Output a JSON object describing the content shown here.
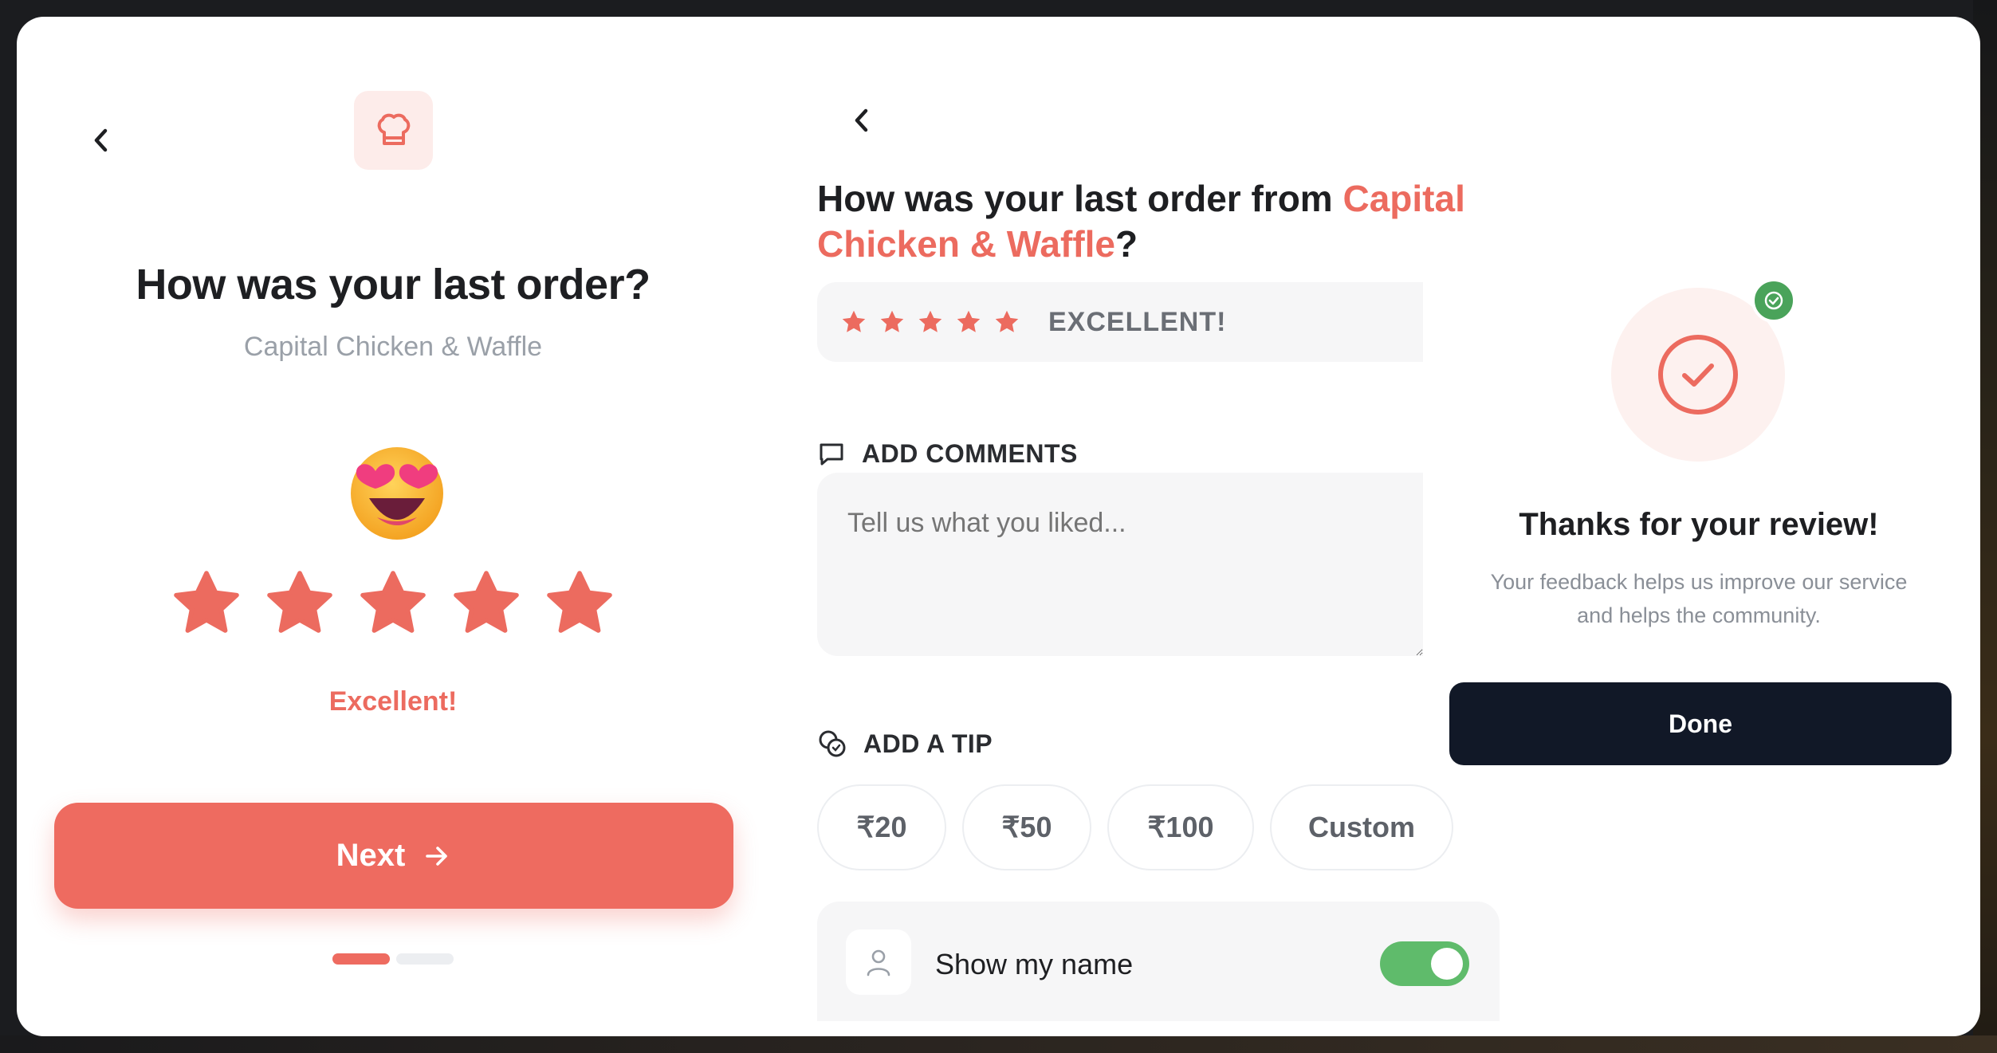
{
  "colors": {
    "accent": "#ec6b5f",
    "accent_bg": "#fdecea",
    "dark": "#111827",
    "success": "#4aa35a",
    "toggle_on": "#5fbb6b"
  },
  "left_panel": {
    "back_icon": "chevron-left-icon",
    "brand_icon": "chef-hat-icon",
    "title": "How was your last order?",
    "subtitle": "Capital Chicken & Waffle",
    "emoji_icon": "heart-eyes-emoji-icon",
    "rating": {
      "value": 5,
      "max": 5
    },
    "rating_text": "Excellent!",
    "next_label": "Next",
    "next_icon": "arrow-right-icon",
    "progress": {
      "current_step": 1,
      "total_steps": 2
    }
  },
  "middle_panel": {
    "back_icon": "chevron-left-icon",
    "title_prefix": "How was your last order from ",
    "title_restaurant": "Capital Chicken & Waffle",
    "title_suffix": "?",
    "rating": {
      "value": 5,
      "max": 5
    },
    "rating_text": "EXCELLENT!",
    "comments_label": "ADD COMMENTS",
    "comments_icon": "chat-bubble-icon",
    "comments_placeholder": "Tell us what you liked...",
    "tip_label": "ADD A TIP",
    "tip_icon": "coins-icon",
    "tip_options": [
      "₹20",
      "₹50",
      "₹100",
      "Custom"
    ],
    "show_name_label": "Show my name",
    "show_name_icon": "user-icon",
    "show_name_enabled": true
  },
  "right_panel": {
    "success_icon": "check-circle-icon",
    "badge_icon": "check-badge-icon",
    "title": "Thanks for your review!",
    "body_line1": "Your feedback helps us improve our service",
    "body_line2": "and helps the community.",
    "done_label": "Done"
  }
}
